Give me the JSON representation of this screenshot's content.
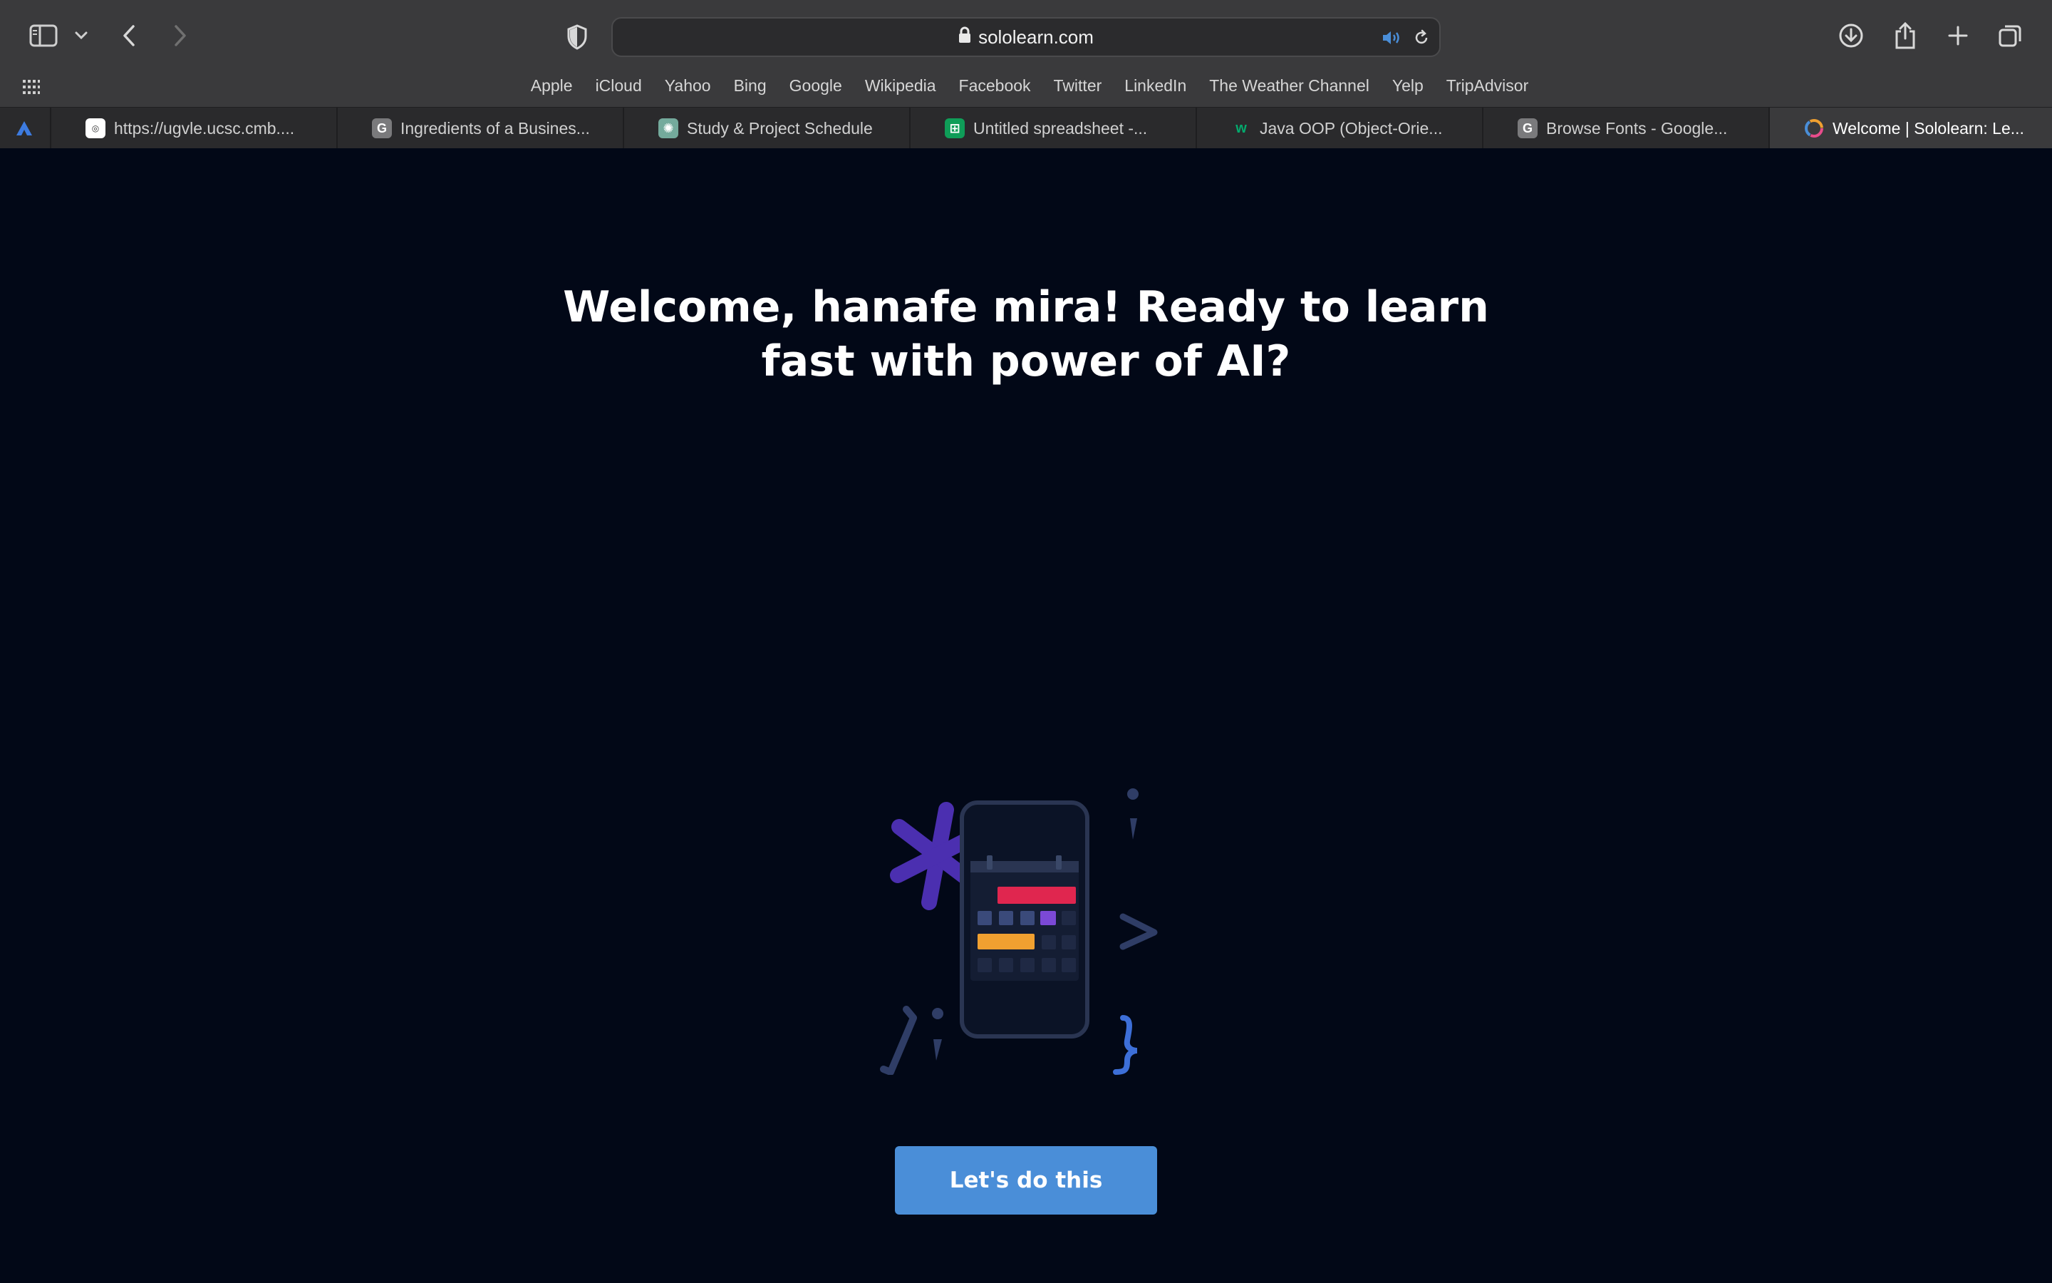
{
  "browser": {
    "url": "sololearn.com",
    "favorites": [
      "Apple",
      "iCloud",
      "Yahoo",
      "Bing",
      "Google",
      "Wikipedia",
      "Facebook",
      "Twitter",
      "LinkedIn",
      "The Weather Channel",
      "Yelp",
      "TripAdvisor"
    ],
    "tabs": [
      {
        "title": "https://ugvle.ucsc.cmb....",
        "icon": "ucsc-favicon",
        "color": "#ffffff"
      },
      {
        "title": "Ingredients of a Busines...",
        "icon": "g-letter-favicon",
        "color": "#7a7a7c"
      },
      {
        "title": "Study & Project Schedule",
        "icon": "chatgpt-favicon",
        "color": "#74aa9c"
      },
      {
        "title": "Untitled spreadsheet -...",
        "icon": "sheets-favicon",
        "color": "#0f9d58"
      },
      {
        "title": "Java OOP (Object-Orie...",
        "icon": "w3schools-favicon",
        "color": "#04aa6d"
      },
      {
        "title": "Browse Fonts - Google...",
        "icon": "g-letter-favicon",
        "color": "#7a7a7c"
      },
      {
        "title": "Welcome | Sololearn: Le...",
        "icon": "sololearn-favicon",
        "color": "#e74c8b",
        "active": true
      }
    ]
  },
  "page": {
    "headline": "Welcome, hanafe mira! Ready to learn fast with power of AI?",
    "cta_label": "Let's do this"
  },
  "colors": {
    "background": "#020817",
    "cta": "#4a8ed8",
    "accent_purple": "#4b2fb0",
    "accent_red": "#e0264f",
    "accent_orange": "#f0a030"
  }
}
